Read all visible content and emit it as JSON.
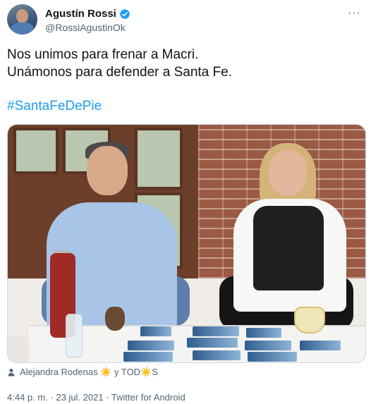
{
  "author": {
    "name": "Agustín Rossi",
    "handle": "@RossiAgustinOk",
    "verified_icon": "verified-badge-icon"
  },
  "menu": {
    "more_label": "···"
  },
  "tweet": {
    "lines": [
      "Nos unimos para frenar a Macri.",
      "Unámonos para defender a Santa Fe."
    ],
    "hashtag": "#SantaFeDePie"
  },
  "media": {
    "tagged_users": "Alejandra Rodenas ☀️ y TOD☀️S"
  },
  "meta": {
    "timestamp": "4:44 p. m. · 23 jul. 2021 · Twitter for Android"
  },
  "colors": {
    "link": "#1d9bf0",
    "secondary": "#536471",
    "text": "#0f1419",
    "border": "#cfd9de"
  }
}
